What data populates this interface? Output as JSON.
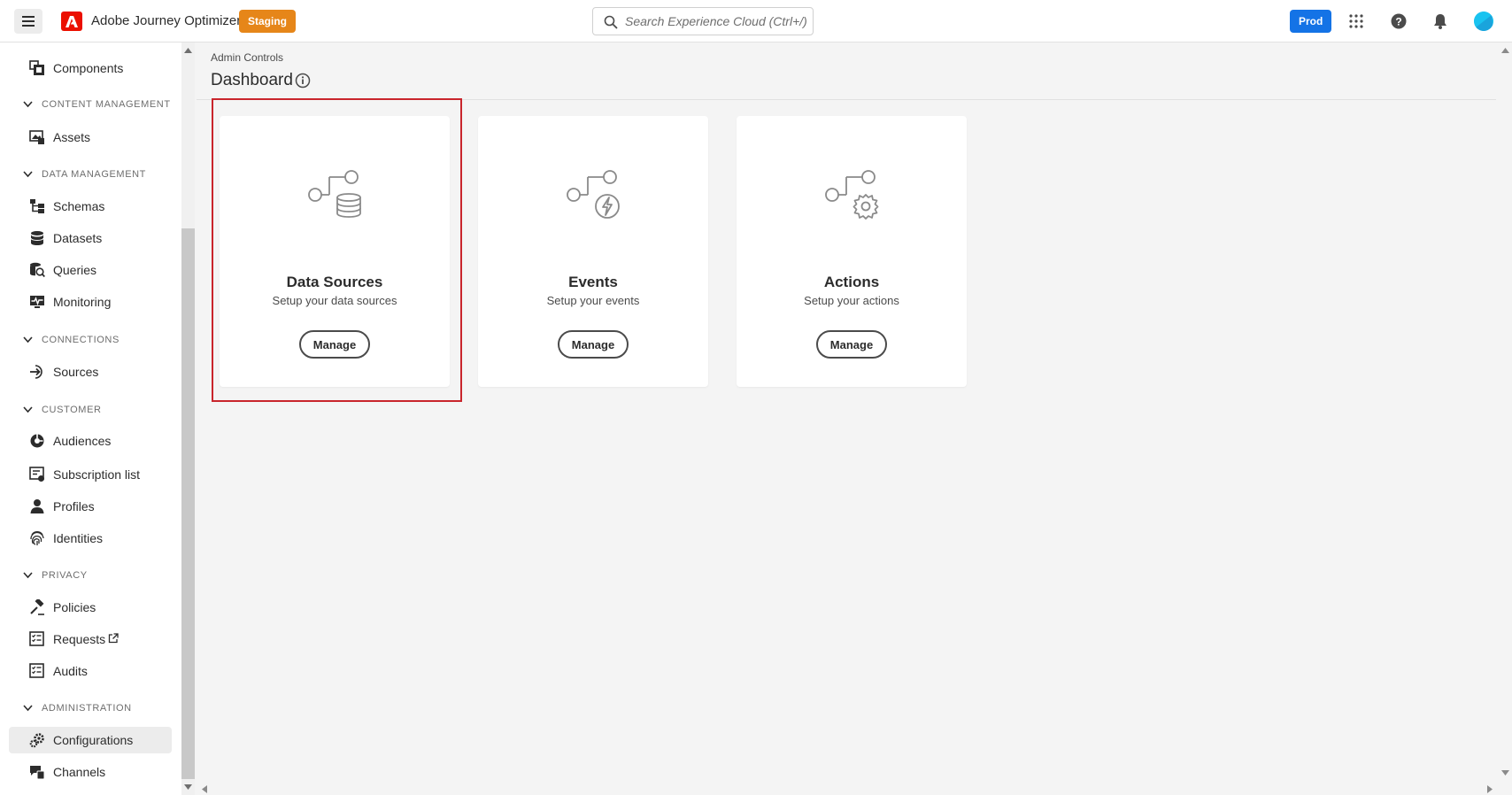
{
  "app": {
    "title": "Adobe Journey Optimizer",
    "env_badge": "Staging",
    "org_badge": "Prod"
  },
  "search": {
    "placeholder": "Search Experience Cloud (Ctrl+/)"
  },
  "colors": {
    "staging": "#e68619",
    "prod": "#1473e6",
    "adobe_red": "#eb1000",
    "highlight": "#c9252c"
  },
  "sidebar": {
    "top_items": [
      {
        "label": "Components",
        "icon": "components-icon"
      }
    ],
    "sections": [
      {
        "label": "CONTENT MANAGEMENT",
        "items": [
          {
            "label": "Assets",
            "icon": "assets-icon"
          }
        ]
      },
      {
        "label": "DATA MANAGEMENT",
        "items": [
          {
            "label": "Schemas",
            "icon": "schemas-icon"
          },
          {
            "label": "Datasets",
            "icon": "datasets-icon"
          },
          {
            "label": "Queries",
            "icon": "queries-icon"
          },
          {
            "label": "Monitoring",
            "icon": "monitoring-icon"
          }
        ]
      },
      {
        "label": "CONNECTIONS",
        "items": [
          {
            "label": "Sources",
            "icon": "sources-icon"
          }
        ]
      },
      {
        "label": "CUSTOMER",
        "items": [
          {
            "label": "Audiences",
            "icon": "audiences-icon"
          },
          {
            "label": "Subscription list",
            "icon": "subscription-list-icon"
          },
          {
            "label": "Profiles",
            "icon": "profiles-icon"
          },
          {
            "label": "Identities",
            "icon": "identities-icon"
          }
        ]
      },
      {
        "label": "PRIVACY",
        "items": [
          {
            "label": "Policies",
            "icon": "policies-icon"
          },
          {
            "label": "Requests",
            "icon": "requests-icon"
          },
          {
            "label": "Audits",
            "icon": "audits-icon"
          }
        ]
      },
      {
        "label": "ADMINISTRATION",
        "items": [
          {
            "label": "Configurations",
            "icon": "configurations-icon",
            "active": true
          },
          {
            "label": "Channels",
            "icon": "channels-icon"
          }
        ]
      }
    ]
  },
  "main": {
    "breadcrumb": "Admin Controls",
    "title": "Dashboard",
    "cards": [
      {
        "title": "Data Sources",
        "description": "Setup your data sources",
        "button": "Manage",
        "icon": "data-sources-icon",
        "highlighted": true
      },
      {
        "title": "Events",
        "description": "Setup your events",
        "button": "Manage",
        "icon": "events-icon"
      },
      {
        "title": "Actions",
        "description": "Setup your actions",
        "button": "Manage",
        "icon": "actions-icon"
      }
    ]
  }
}
